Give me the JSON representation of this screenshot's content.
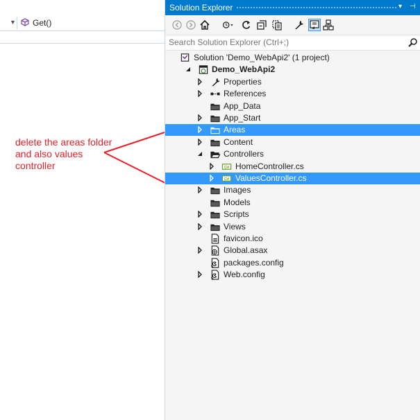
{
  "editor": {
    "method_label": "Get()"
  },
  "annotation": {
    "lines": [
      "delete the areas folder",
      "and also values",
      "controller"
    ]
  },
  "solution_explorer": {
    "title": "Solution Explorer",
    "title_controls": [
      "▾",
      "⊣"
    ],
    "search": {
      "placeholder": "Search Solution Explorer (Ctrl+;)"
    },
    "toolbar": [
      {
        "name": "back-icon"
      },
      {
        "name": "forward-icon"
      },
      {
        "name": "home-icon"
      },
      {
        "name": "history-dropdown-icon"
      },
      {
        "name": "refresh-icon"
      },
      {
        "name": "collapse-all-icon"
      },
      {
        "name": "show-all-files-icon"
      },
      {
        "name": "properties-icon"
      },
      {
        "name": "preview-icon"
      },
      {
        "name": "class-view-icon"
      }
    ],
    "tree": [
      {
        "label": "Solution 'Demo_WebApi2' (1 project)",
        "icon": "solution-icon",
        "expander": "none",
        "bold": false,
        "selected": false
      },
      {
        "label": "Demo_WebApi2",
        "icon": "web-project-icon",
        "expander": "expanded",
        "bold": true,
        "selected": false
      },
      {
        "label": "Properties",
        "icon": "wrench-icon",
        "expander": "collapsed",
        "bold": false,
        "selected": false
      },
      {
        "label": "References",
        "icon": "references-icon",
        "expander": "collapsed",
        "bold": false,
        "selected": false
      },
      {
        "label": "App_Data",
        "icon": "folder-icon",
        "expander": "none",
        "bold": false,
        "selected": false
      },
      {
        "label": "App_Start",
        "icon": "folder-icon",
        "expander": "collapsed",
        "bold": false,
        "selected": false
      },
      {
        "label": "Areas",
        "icon": "folder-icon",
        "expander": "collapsed",
        "bold": false,
        "selected": true
      },
      {
        "label": "Content",
        "icon": "folder-icon",
        "expander": "collapsed",
        "bold": false,
        "selected": false
      },
      {
        "label": "Controllers",
        "icon": "folder-open-icon",
        "expander": "expanded",
        "bold": false,
        "selected": false
      },
      {
        "label": "HomeController.cs",
        "icon": "csharp-file-icon",
        "expander": "collapsed",
        "bold": false,
        "selected": false
      },
      {
        "label": "ValuesController.cs",
        "icon": "csharp-file-icon",
        "expander": "collapsed",
        "bold": false,
        "selected": true
      },
      {
        "label": "Images",
        "icon": "folder-icon",
        "expander": "collapsed",
        "bold": false,
        "selected": false
      },
      {
        "label": "Models",
        "icon": "folder-icon",
        "expander": "none",
        "bold": false,
        "selected": false
      },
      {
        "label": "Scripts",
        "icon": "folder-icon",
        "expander": "collapsed",
        "bold": false,
        "selected": false
      },
      {
        "label": "Views",
        "icon": "folder-icon",
        "expander": "collapsed",
        "bold": false,
        "selected": false
      },
      {
        "label": "favicon.ico",
        "icon": "ico-file-icon",
        "expander": "none",
        "bold": false,
        "selected": false
      },
      {
        "label": "Global.asax",
        "icon": "global-asax-icon",
        "expander": "collapsed",
        "bold": false,
        "selected": false
      },
      {
        "label": "packages.config",
        "icon": "config-file-icon",
        "expander": "none",
        "bold": false,
        "selected": false
      },
      {
        "label": "Web.config",
        "icon": "config-file-icon",
        "expander": "collapsed",
        "bold": false,
        "selected": false
      }
    ],
    "colors": {
      "title_bar": "#007acc",
      "selection": "#3399ff",
      "annotation": "#e8202a",
      "csharp_badge": "#68a52b"
    }
  }
}
